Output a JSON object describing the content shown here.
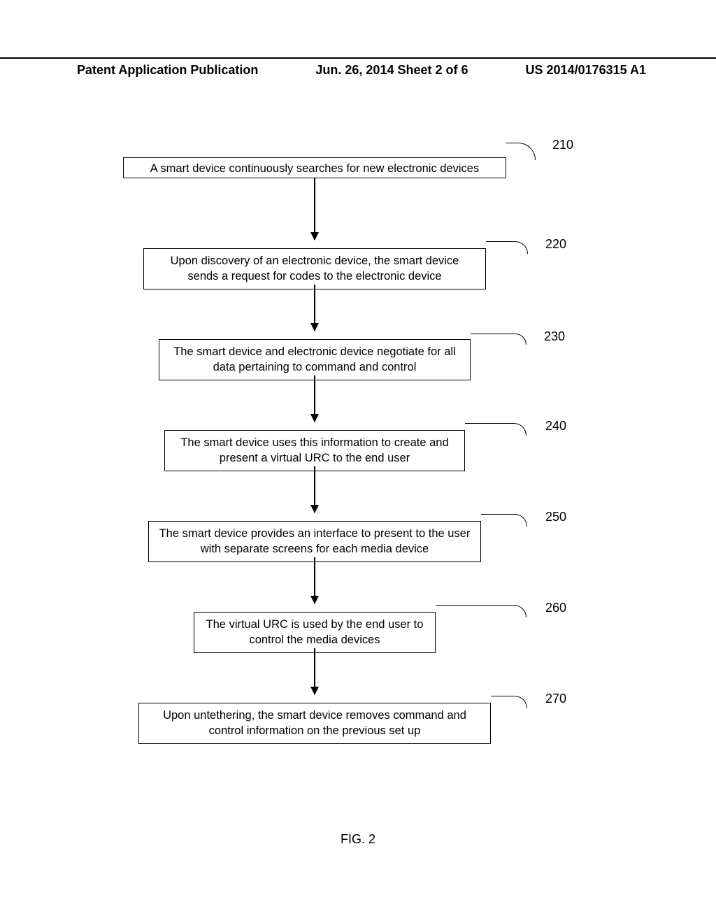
{
  "header": {
    "left": "Patent Application Publication",
    "center": "Jun. 26, 2014  Sheet 2 of 6",
    "right": "US 2014/0176315 A1"
  },
  "steps": [
    {
      "ref": "210",
      "text": "A smart device continuously searches for new electronic devices"
    },
    {
      "ref": "220",
      "text": "Upon discovery of an electronic device, the smart device sends a request for codes to the electronic device"
    },
    {
      "ref": "230",
      "text": "The smart device and electronic device negotiate for all data pertaining to command and control"
    },
    {
      "ref": "240",
      "text": "The smart device uses this information to create and present a virtual URC to the end user"
    },
    {
      "ref": "250",
      "text": "The smart device provides an interface to present to the user with separate screens for each media device"
    },
    {
      "ref": "260",
      "text": "The virtual URC is used by the end user to control the media devices"
    },
    {
      "ref": "270",
      "text": "Upon untethering, the smart device removes command and control information on the previous set up"
    }
  ],
  "figure_label": "FIG. 2"
}
